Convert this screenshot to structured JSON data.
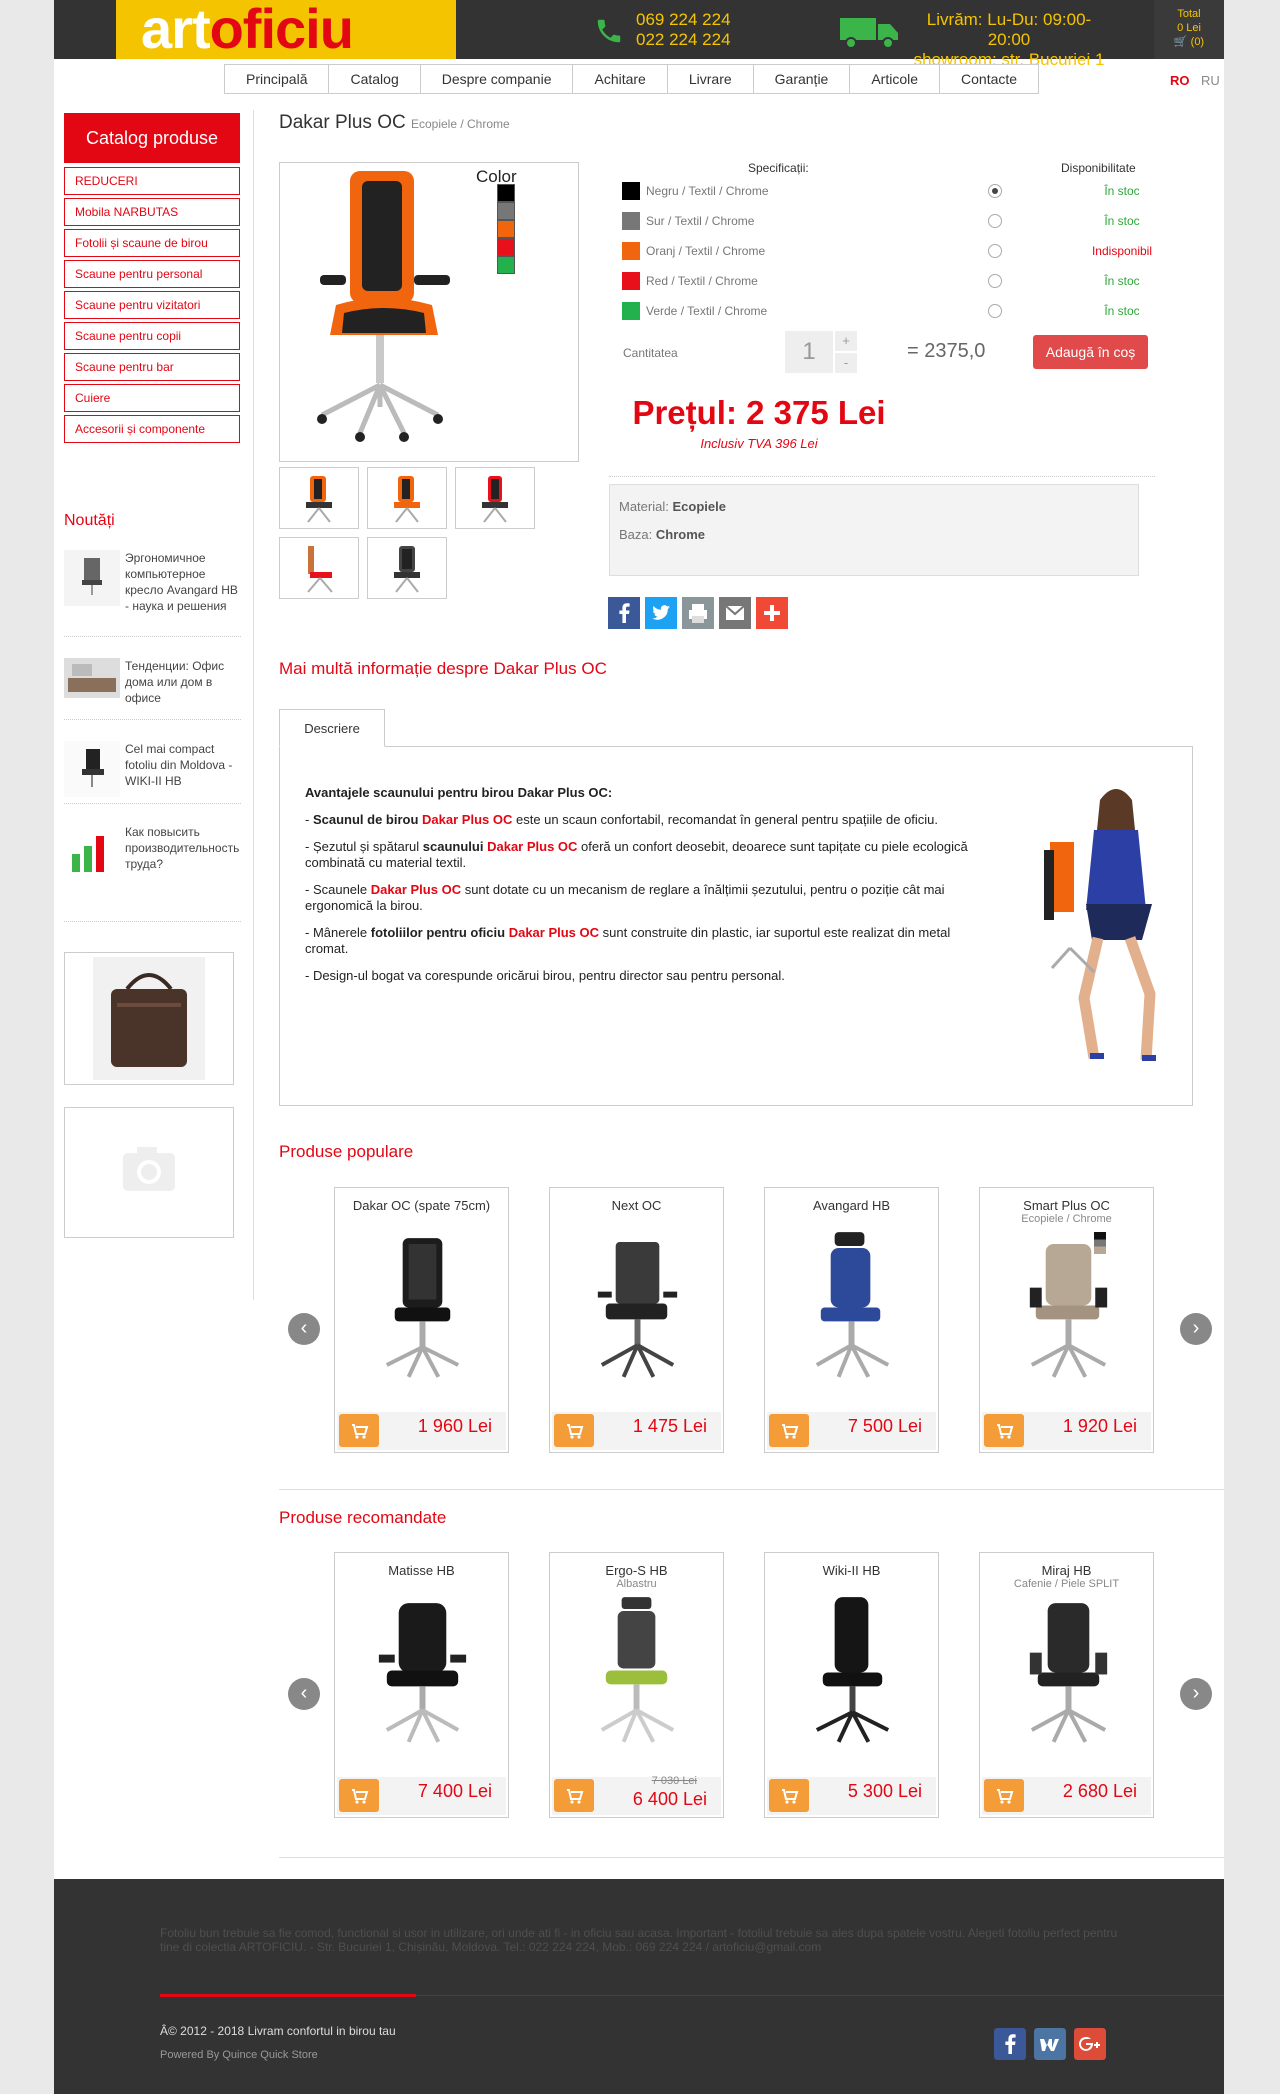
{
  "header": {
    "logo_a": "art",
    "logo_b": "oficiu",
    "phone1": "069 224 224",
    "phone2": "022 224 224",
    "delivery1": "Livrăm: Lu-Du: 09:00-20:00",
    "delivery2": "showroom: str. Bucuriei 1",
    "cart_total_label": "Total",
    "cart_total_value": "0 Lei",
    "cart_count": "(0)"
  },
  "nav": [
    "Principală",
    "Catalog",
    "Despre companie",
    "Achitare",
    "Livrare",
    "Garanție",
    "Articole",
    "Contacte"
  ],
  "lang": {
    "ro": "RO",
    "ru": "RU"
  },
  "sidebar": {
    "title": "Catalog produse",
    "items": [
      "REDUCERI",
      "Mobila NARBUTAS",
      "Fotolii și scaune de birou",
      "Scaune pentru personal",
      "Scaune pentru vizitatori",
      "Scaune pentru copii",
      "Scaune pentru bar",
      "Cuiere",
      "Accesorii și componente"
    ]
  },
  "news": {
    "title": "Noutăți",
    "items": [
      "Эргономичное компьютерное кресло Avangard HB - наука и решения",
      "Тенденции: Офис дома или дом в офисе",
      "Cel mai compact fotoliu din Moldova - WIKI-II HB",
      "Как повысить производительность труда?"
    ]
  },
  "product": {
    "name": "Dakar Plus OC",
    "subtitle": "Ecopiele / Chrome",
    "image_label": "Color",
    "spec_header": "Specificații:",
    "avail_header": "Disponibilitate",
    "variants": [
      {
        "label": "Negru / Textil / Chrome",
        "color": "#000000",
        "stock": "În stoc",
        "stock_color": "#2ea83a",
        "selected": true
      },
      {
        "label": "Sur / Textil / Chrome",
        "color": "#777777",
        "stock": "În stoc",
        "stock_color": "#2ea83a",
        "selected": false
      },
      {
        "label": "Oranj / Textil / Chrome",
        "color": "#f0650e",
        "stock": "Indisponibil",
        "stock_color": "#e30613",
        "selected": false
      },
      {
        "label": "Red / Textil / Chrome",
        "color": "#e8101a",
        "stock": "În stoc",
        "stock_color": "#2ea83a",
        "selected": false
      },
      {
        "label": "Verde / Textil / Chrome",
        "color": "#22b14c",
        "stock": "În stoc",
        "stock_color": "#2ea83a",
        "selected": false
      }
    ],
    "qty_label": "Cantitatea",
    "qty": "1",
    "qty_plus": "+",
    "qty_minus": "-",
    "total": "= 2375,0",
    "add_to_cart": "Adaugă în coș",
    "price": "Prețul: 2 375 Lei",
    "vat": "Inclusiv TVA 396 Lei",
    "material_label": "Material:",
    "material_value": "Ecopiele",
    "base_label": "Baza:",
    "base_value": "Chrome"
  },
  "details": {
    "title": "Mai multă informație despre Dakar Plus OC",
    "tab": "Descriere",
    "heading": "Avantajele scaunului pentru birou Dakar Plus OC:",
    "p1_a": "- ",
    "p1_b": "Scaunul de birou",
    "p1_c": "Dakar Plus OC",
    "p1_d": " este un scaun confortabil, recomandat în general pentru spațiile de oficiu.",
    "p2_a": "- Șezutul și spătarul ",
    "p2_b": "scaunului",
    "p2_c": "Dakar Plus OC",
    "p2_d": " oferă un confort deosebit, deoarece sunt tapițate cu piele ecologică combinată cu material textil.",
    "p3_a": "- Scaunele ",
    "p3_c": "Dakar Plus OC",
    "p3_d": " sunt dotate cu un mecanism de reglare a înălțimii șezutului, pentru o poziție cât mai ergonomică la birou.",
    "p4_a": "- Mânerele ",
    "p4_b": "fotoliilor pentru oficiu",
    "p4_c": "Dakar Plus OC",
    "p4_d": " sunt construite din plastic, iar suportul este realizat din metal cromat.",
    "p5": "- Design-ul bogat va corespunde oricărui birou, pentru director sau pentru personal."
  },
  "popular": {
    "title": "Produse populare",
    "items": [
      {
        "name": "Dakar OC (spate 75cm)",
        "sub": "",
        "price": "1 960 Lei",
        "old": ""
      },
      {
        "name": "Next OC",
        "sub": "",
        "price": "1 475 Lei",
        "old": ""
      },
      {
        "name": "Avangard HB",
        "sub": "",
        "price": "7 500 Lei",
        "old": ""
      },
      {
        "name": "Smart Plus OC",
        "sub": "Ecopiele / Chrome",
        "price": "1 920 Lei",
        "old": ""
      }
    ]
  },
  "recommended": {
    "title": "Produse recomandate",
    "items": [
      {
        "name": "Matisse HB",
        "sub": "",
        "price": "7 400 Lei",
        "old": ""
      },
      {
        "name": "Ergo-S HB",
        "sub": "Albastru",
        "price": "6 400 Lei",
        "old": "7 030 Lei"
      },
      {
        "name": "Wiki-II HB",
        "sub": "",
        "price": "5 300 Lei",
        "old": ""
      },
      {
        "name": "Miraj HB",
        "sub": "Cafenie / Piele SPLIT",
        "price": "2 680 Lei",
        "old": ""
      }
    ]
  },
  "footer": {
    "text": "Fotoliu bun trebuie sa fie comod, functional si usor in utilizare, ori unde ati fi - in oficiu sau acasa. Important - fotoliul trebuie sa ales dupa spatele vostru. Alegeti fotoliu perfect pentru tine di colectia ARTOFICIU. - Str. Bucuriei 1, Chișinău, Moldova. Tel.: 022 224 224, Mob.: 069 224 224 / artoficiu@gmail.com",
    "copyright": "Â© 2012 - 2018 Livram confortul in birou tau",
    "powered": "Powered By Quince Quick Store"
  },
  "colors": {
    "brand_red": "#e30613",
    "brand_yellow": "#f5c400",
    "dark": "#333333",
    "cart_orange": "#f39c38"
  }
}
